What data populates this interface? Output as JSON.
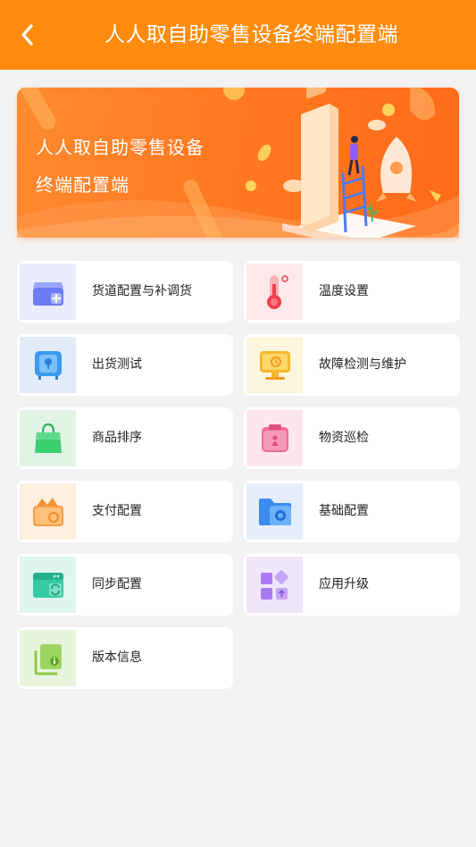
{
  "header": {
    "title": "人人取自助零售设备终端配置端",
    "back_icon": "chevron-left-icon"
  },
  "banner": {
    "line1": "人人取自助零售设备",
    "line2": "终端配置端"
  },
  "menu": [
    {
      "label": "货道配置与补调货",
      "icon": "box-plus-icon",
      "bg": "#e9ecfb",
      "color": "#6b7cf5"
    },
    {
      "label": "温度设置",
      "icon": "thermometer-icon",
      "bg": "#fde8ea",
      "color": "#f0414b"
    },
    {
      "label": "出货测试",
      "icon": "safe-icon",
      "bg": "#e2ecf8",
      "color": "#3a9bf0"
    },
    {
      "label": "故障检测与维护",
      "icon": "monitor-icon",
      "bg": "#fdf6dc",
      "color": "#f5b82e"
    },
    {
      "label": "商品排序",
      "icon": "shopping-bag-icon",
      "bg": "#e2f3e6",
      "color": "#3ccf6e"
    },
    {
      "label": "物资巡检",
      "icon": "clipboard-icon",
      "bg": "#fde6ef",
      "color": "#f06c98"
    },
    {
      "label": "支付配置",
      "icon": "wallet-icon",
      "bg": "#fdeedd",
      "color": "#f5a24a"
    },
    {
      "label": "基础配置",
      "icon": "folder-icon",
      "bg": "#e5effb",
      "color": "#3b8bf0"
    },
    {
      "label": "同步配置",
      "icon": "sync-window-icon",
      "bg": "#dff5ef",
      "color": "#35c9a4"
    },
    {
      "label": "应用升级",
      "icon": "app-grid-icon",
      "bg": "#f0e6fb",
      "color": "#a87cf0"
    },
    {
      "label": "版本信息",
      "icon": "info-docs-icon",
      "bg": "#e8f5dc",
      "color": "#8acb4a"
    }
  ]
}
